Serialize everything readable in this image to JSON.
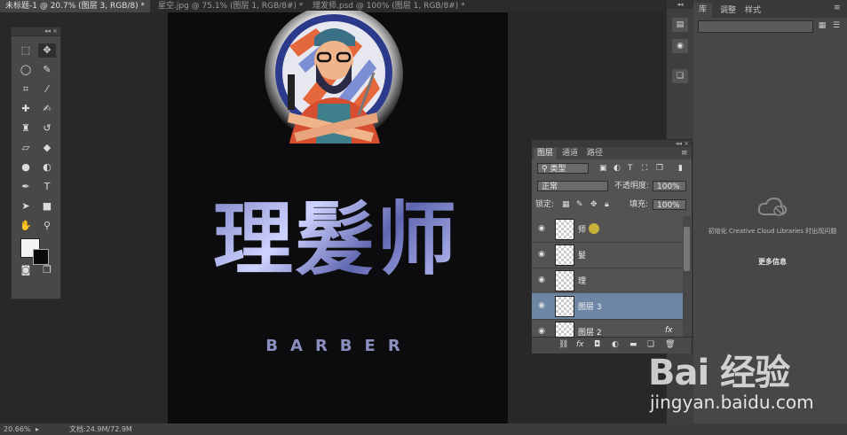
{
  "doc_tabs": [
    {
      "label": "未标题-1 @ 20.7% (图层 3, RGB/8) *",
      "active": true
    },
    {
      "label": "星空.jpg @ 75.1% (图层 1, RGB/8#) *",
      "active": false
    },
    {
      "label": "理发师.psd @ 100% (图层 1, RGB/8#) *",
      "active": false
    }
  ],
  "canvas": {
    "title_chars": [
      "理",
      "髮",
      "师"
    ],
    "subtitle": "BARBER"
  },
  "status": {
    "zoom": "20.66%",
    "doc_info": "文档:24.9M/72.9M"
  },
  "library_panel": {
    "tabs": [
      "库",
      "调整",
      "样式"
    ],
    "init_message": "初始化 Creative Cloud Libraries 时出现问题",
    "more_info": "更多信息"
  },
  "layers_panel": {
    "tabs": [
      "图层",
      "通道",
      "路径"
    ],
    "filter_type": "类型",
    "blend_mode": "正常",
    "opacity_label": "不透明度:",
    "opacity_value": "100%",
    "lock_label": "锁定:",
    "fill_label": "填充:",
    "fill_value": "100%",
    "layers": [
      {
        "name": "师",
        "selected": false
      },
      {
        "name": "髮",
        "selected": false
      },
      {
        "name": "理",
        "selected": false
      },
      {
        "name": "图层 3",
        "selected": true
      },
      {
        "name": "图层 2",
        "selected": false
      }
    ],
    "fx_label": "fx"
  },
  "watermark": {
    "brand": "Bai 经验",
    "url": "jingyan.baidu.com"
  },
  "colors": {
    "workspace": "#282828",
    "canvas": "#0c0c0e",
    "selected_layer": "#6c86a4",
    "panel": "#535353"
  }
}
